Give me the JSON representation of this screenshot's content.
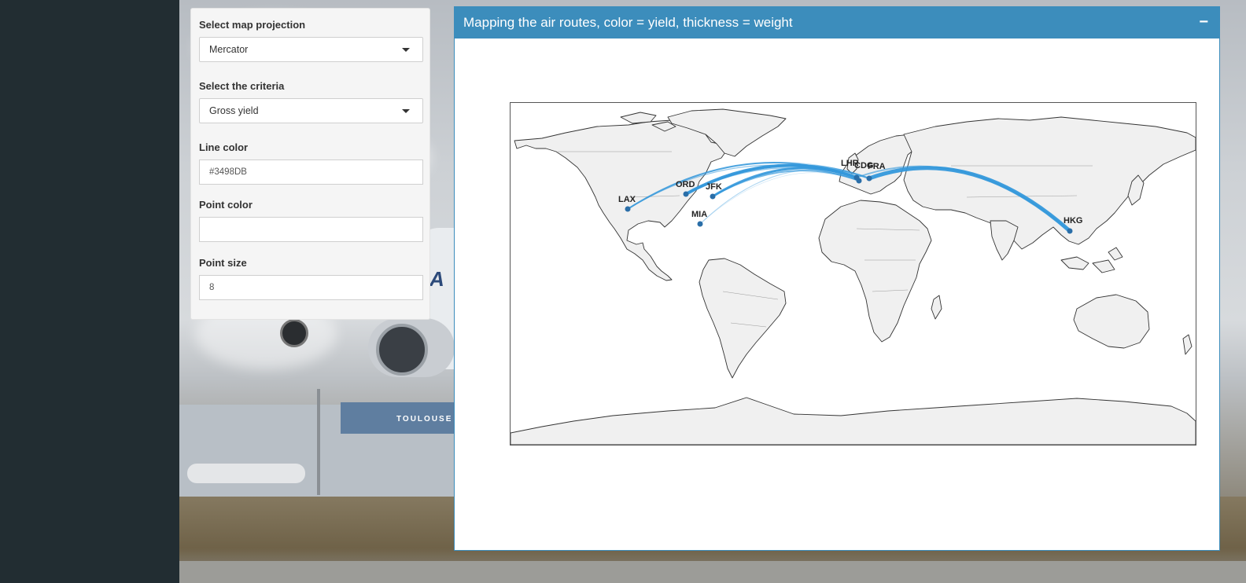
{
  "controls": {
    "projection_label": "Select map projection",
    "projection_value": "Mercator",
    "criteria_label": "Select the criteria",
    "criteria_value": "Gross yield",
    "line_color_label": "Line color",
    "line_color_value": "#3498DB",
    "point_color_label": "Point color",
    "point_color_value": "",
    "point_size_label": "Point size",
    "point_size_value": "8"
  },
  "box": {
    "title": "Mapping the air routes, color = yield, thickness = weight",
    "collapse_icon": "−"
  },
  "background": {
    "terminal_sign": "TOULOUSE"
  },
  "map": {
    "projection": "Mercator",
    "line_color": "#3498DB",
    "point_color": "#2a6ea8",
    "airports": [
      {
        "code": "LAX"
      },
      {
        "code": "ORD"
      },
      {
        "code": "JFK"
      },
      {
        "code": "MIA"
      },
      {
        "code": "LHR"
      },
      {
        "code": "CDG"
      },
      {
        "code": "FRA"
      },
      {
        "code": "HKG"
      }
    ]
  }
}
